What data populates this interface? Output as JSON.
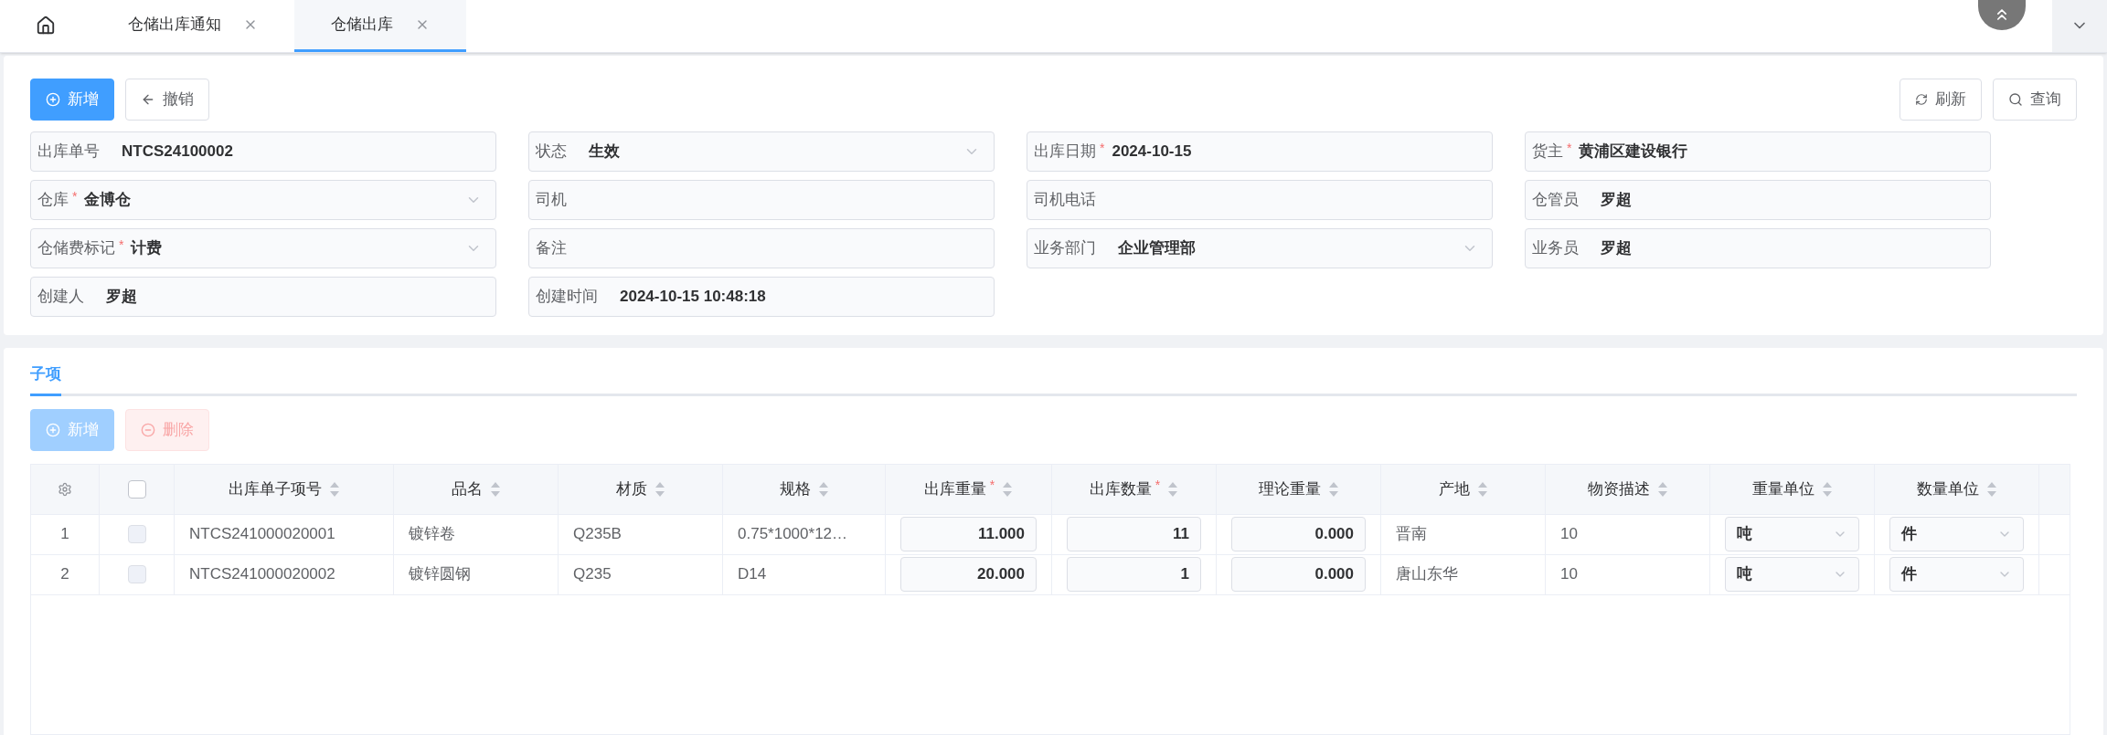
{
  "tabs": [
    {
      "label": "仓储出库通知",
      "selected": false
    },
    {
      "label": "仓储出库",
      "selected": true
    }
  ],
  "toolbar_left": [
    {
      "label": "新增",
      "kind": "primary",
      "disabled": false
    },
    {
      "label": "撤销",
      "kind": "back",
      "disabled": false
    }
  ],
  "toolbar_right": [
    {
      "label": "刷新",
      "kind": "refresh",
      "disabled": false
    },
    {
      "label": "查询",
      "kind": "search",
      "disabled": false
    }
  ],
  "form_rows": [
    [
      {
        "label": "出库单号",
        "value": "NTCS24100002",
        "kind": "text"
      },
      {
        "label": "状态",
        "value": "生效",
        "kind": "select"
      },
      {
        "label": "出库日期",
        "mark": "*",
        "value": "2024-10-15",
        "kind": "text"
      },
      {
        "label": "货主",
        "mark": "*",
        "value": "黄浦区建设银行",
        "kind": "text"
      }
    ],
    [
      {
        "label": "仓库",
        "mark": "*",
        "value": "金博仓",
        "kind": "select"
      },
      {
        "label": "司机",
        "kind": "text"
      },
      {
        "label": "司机电话",
        "kind": "text"
      },
      {
        "label": "仓管员",
        "value": "罗超",
        "kind": "text"
      }
    ],
    [
      {
        "label": "仓储费标记",
        "mark": "*",
        "value": "计费",
        "kind": "select"
      },
      {
        "label": "备注",
        "kind": "text"
      },
      {
        "label": "业务部门",
        "value": "企业管理部",
        "kind": "select"
      },
      {
        "label": "业务员",
        "value": "罗超",
        "kind": "text"
      }
    ],
    [
      {
        "label": "创建人",
        "value": "罗超",
        "kind": "text"
      },
      {
        "label": "创建时间",
        "value": "2024-10-15 10:48:18",
        "kind": "text"
      }
    ]
  ],
  "section_tabs": [
    {
      "label": "子项",
      "selected": true
    }
  ],
  "sub_toolbar": [
    {
      "label": "新增",
      "kind": "primary",
      "disabled": true
    },
    {
      "label": "删除",
      "kind": "danger",
      "disabled": true
    }
  ],
  "table": {
    "header_checked": false,
    "columns": [
      {
        "label": "出库单子项号"
      },
      {
        "label": "品名"
      },
      {
        "label": "材质"
      },
      {
        "label": "规格"
      },
      {
        "label": "出库重量",
        "mark": "*"
      },
      {
        "label": "出库数量",
        "mark": "*"
      },
      {
        "label": "理论重量"
      },
      {
        "label": "产地"
      },
      {
        "label": "物资描述"
      },
      {
        "label": "重量单位"
      },
      {
        "label": "数量单位"
      }
    ],
    "rows": [
      {
        "index": "1",
        "checked": false,
        "cells": [
          {
            "kind": "text",
            "value": "NTCS241000020001"
          },
          {
            "kind": "text",
            "value": "镀锌卷"
          },
          {
            "kind": "text",
            "value": "Q235B"
          },
          {
            "kind": "text",
            "value": "0.75*1000*12…"
          },
          {
            "kind": "number",
            "value": "11.000"
          },
          {
            "kind": "number",
            "value": "11"
          },
          {
            "kind": "number",
            "value": "0.000"
          },
          {
            "kind": "text",
            "value": "晋南"
          },
          {
            "kind": "text",
            "value": "10"
          },
          {
            "kind": "select",
            "value": "吨"
          },
          {
            "kind": "select",
            "value": "件"
          }
        ]
      },
      {
        "index": "2",
        "checked": false,
        "cells": [
          {
            "kind": "text",
            "value": "NTCS241000020002"
          },
          {
            "kind": "text",
            "value": "镀锌圆钢"
          },
          {
            "kind": "text",
            "value": "Q235"
          },
          {
            "kind": "text",
            "value": "D14"
          },
          {
            "kind": "number",
            "value": "20.000"
          },
          {
            "kind": "number",
            "value": "1"
          },
          {
            "kind": "number",
            "value": "0.000"
          },
          {
            "kind": "text",
            "value": "唐山东华"
          },
          {
            "kind": "text",
            "value": "10"
          },
          {
            "kind": "select",
            "value": "吨"
          },
          {
            "kind": "select",
            "value": "件"
          }
        ]
      }
    ]
  }
}
